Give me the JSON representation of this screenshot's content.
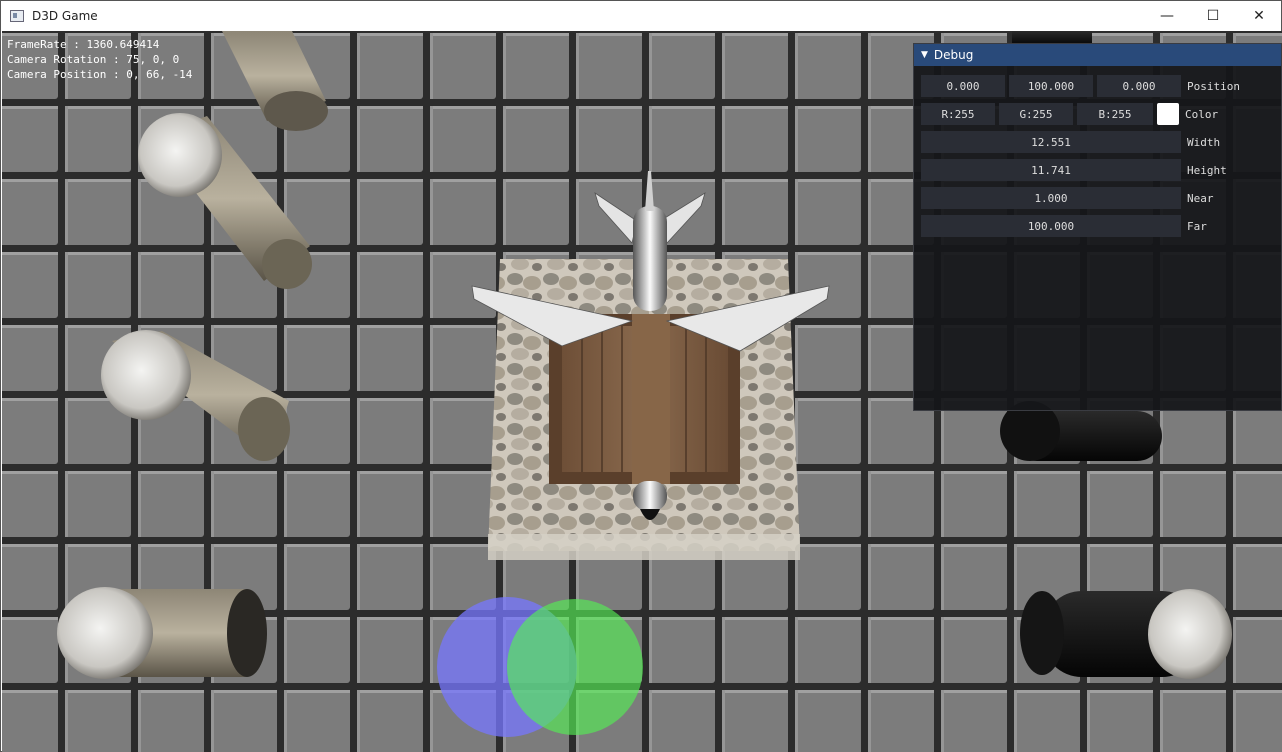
{
  "window": {
    "title": "D3D Game"
  },
  "controls": {
    "minimize": "—",
    "maximize": "☐",
    "close": "✕"
  },
  "stats": {
    "framerate": "FrameRate : 1360.649414",
    "rotation": "Camera Rotation : 75, 0, 0",
    "position": "Camera Position : 0, 66, -14"
  },
  "debug": {
    "title": "Debug",
    "position": {
      "x": "0.000",
      "y": "100.000",
      "z": "0.000",
      "label": "Position"
    },
    "color": {
      "r": "R:255",
      "g": "G:255",
      "b": "B:255",
      "label": "Color",
      "swatch": "#ffffff"
    },
    "width": {
      "value": "12.551",
      "label": "Width"
    },
    "height": {
      "value": "11.741",
      "label": "Height"
    },
    "near": {
      "value": "1.000",
      "label": "Near"
    },
    "far": {
      "value": "100.000",
      "label": "Far"
    }
  },
  "scene_colors": {
    "floor": "#7a7a7a",
    "grout": "#2c2c2c",
    "crate": "#7a5a40",
    "light_blue": "#7777ff",
    "light_green": "#55ee55"
  }
}
